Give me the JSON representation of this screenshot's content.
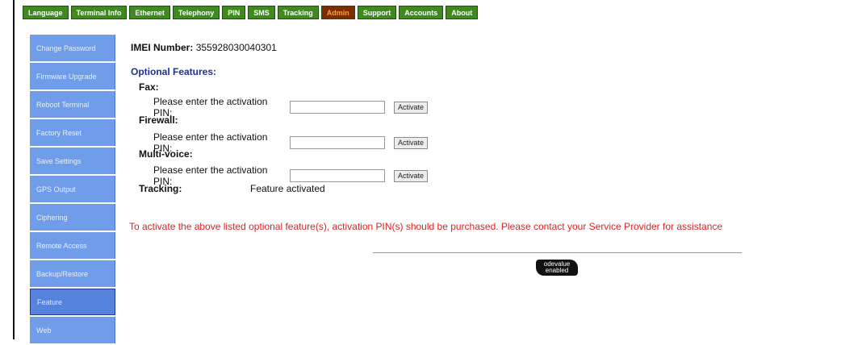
{
  "topnav": {
    "tabs": [
      {
        "label": "Language"
      },
      {
        "label": "Terminal Info"
      },
      {
        "label": "Ethernet"
      },
      {
        "label": "Telephony"
      },
      {
        "label": "PIN"
      },
      {
        "label": "SMS"
      },
      {
        "label": "Tracking"
      },
      {
        "label": "Admin"
      },
      {
        "label": "Support"
      },
      {
        "label": "Accounts"
      },
      {
        "label": "About"
      }
    ],
    "active": "Admin"
  },
  "sidebar": {
    "items": [
      {
        "label": "Change Password"
      },
      {
        "label": "Firmware Upgrade"
      },
      {
        "label": "Reboot Terminal"
      },
      {
        "label": "Factory Reset"
      },
      {
        "label": "Save Settings"
      },
      {
        "label": "GPS Output"
      },
      {
        "label": "Ciphering"
      },
      {
        "label": "Remote Access"
      },
      {
        "label": "Backup/Restore"
      },
      {
        "label": "Feature"
      },
      {
        "label": "Web"
      }
    ],
    "selected": "Feature"
  },
  "main": {
    "imei_label": "IMEI Number:",
    "imei_value": "355928030040301",
    "optional_title": "Optional Features:",
    "features": [
      {
        "name": "Fax:",
        "pin_prompt": "Please enter the activation PIN:",
        "pin_value": "",
        "button": "Activate"
      },
      {
        "name": "Firewall:",
        "pin_prompt": "Please enter the activation PIN:",
        "pin_value": "",
        "button": "Activate"
      },
      {
        "name": "Multi-voice:",
        "pin_prompt": "Please enter the activation PIN:",
        "pin_value": "",
        "button": "Activate"
      }
    ],
    "tracking_label": "Tracking:",
    "tracking_status": "Feature activated",
    "notice": "To activate the above listed optional feature(s), activation PIN(s) should be purchased. Please contact your Service Provider for assistance",
    "badge_line1": "odevalue",
    "badge_line2": "enabled"
  },
  "colors": {
    "tab_bg": "#3f8a1f",
    "tab_active_bg": "#7a2e00",
    "tab_active_text": "#ff9d3c",
    "sidebar_bg": "#6f9dea",
    "title_blue": "#1f2e9a",
    "notice_red": "#e12020"
  }
}
